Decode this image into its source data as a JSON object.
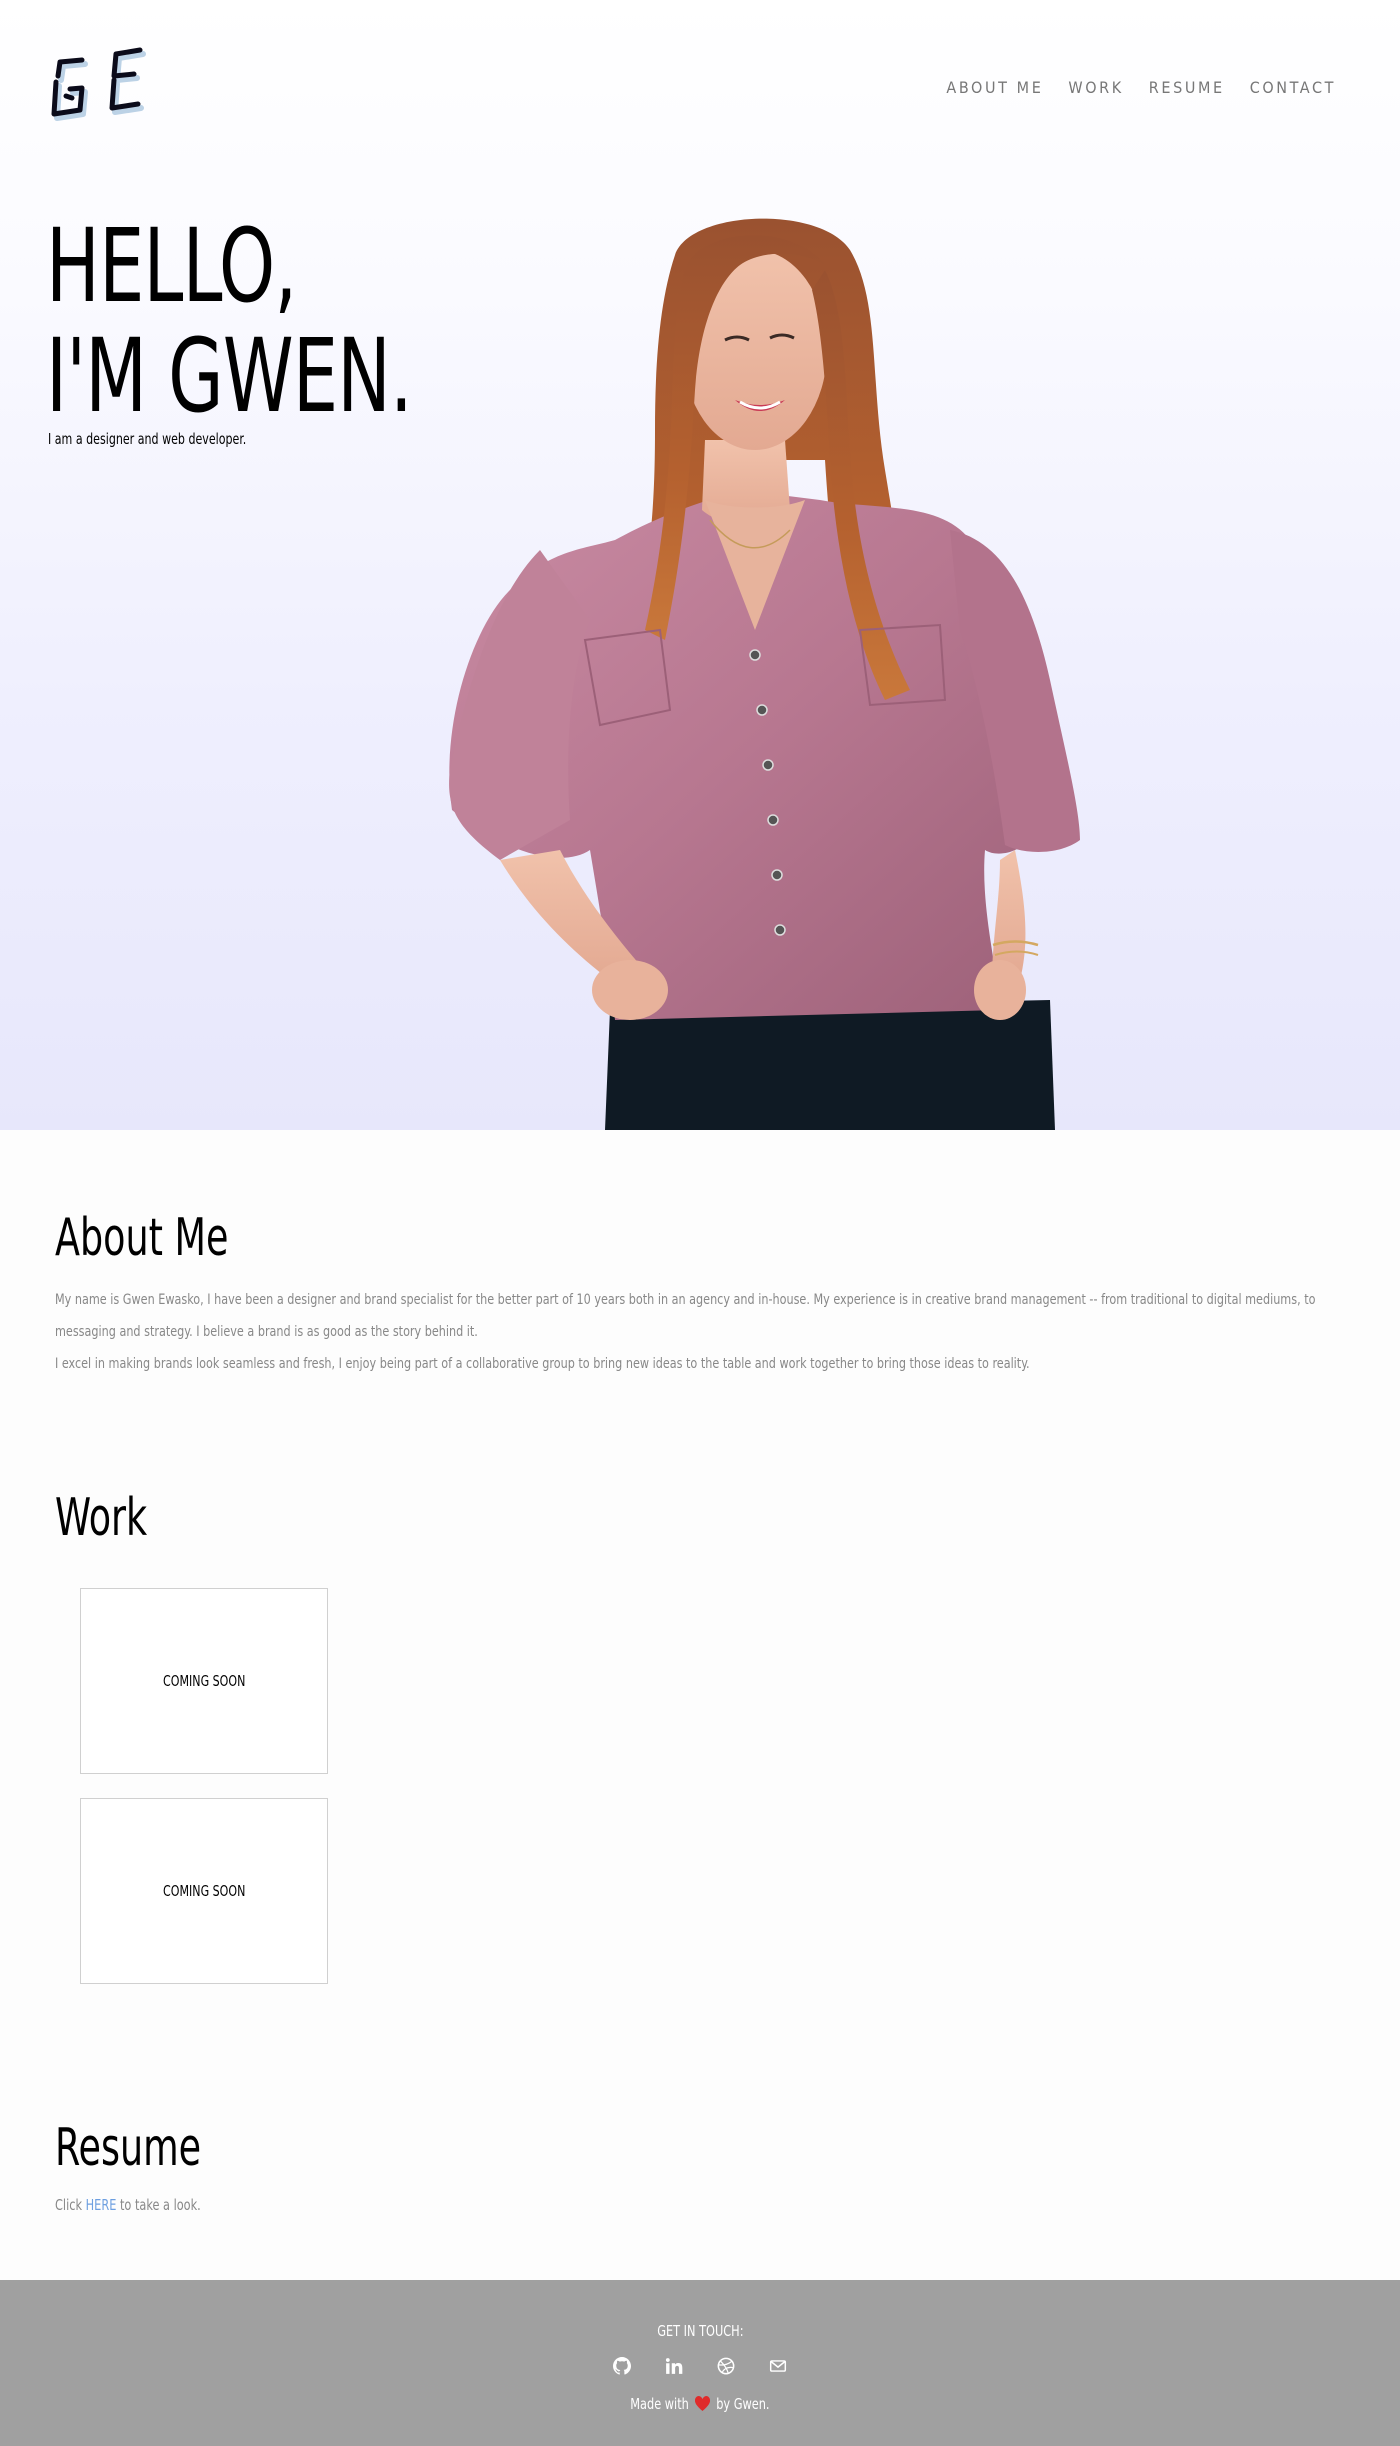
{
  "nav": {
    "items": [
      {
        "label": "ABOUT ME"
      },
      {
        "label": "WORK"
      },
      {
        "label": "RESUME"
      },
      {
        "label": "CONTACT"
      }
    ]
  },
  "hero": {
    "title_line1": "HELLO,",
    "title_line2": "I'M GWEN.",
    "subtitle": "I am a designer and web developer."
  },
  "about": {
    "heading": "About Me",
    "paragraph1": "My name is Gwen Ewasko, I have been a designer and brand specialist for the better part of 10 years both in an agency and in-house. My experience is in creative brand management -- from traditional to digital mediums, to messaging and strategy. I believe a brand is as good as the story behind it.",
    "paragraph2": "I excel in making brands look seamless and fresh, I enjoy being part of a collaborative group to bring new ideas to the table and work together to bring those ideas to reality."
  },
  "work": {
    "heading": "Work",
    "cards": [
      {
        "label": "COMING SOON"
      },
      {
        "label": "COMING SOON"
      }
    ]
  },
  "resume": {
    "heading": "Resume",
    "prefix": "Click",
    "link_label": "HERE",
    "suffix": "to take a look."
  },
  "footer": {
    "title": "GET IN TOUCH:",
    "social_icons": [
      "github-icon",
      "linkedin-icon",
      "dribbble-icon",
      "mail-icon"
    ],
    "made_prefix": "Made with",
    "made_suffix": "by Gwen."
  },
  "colors": {
    "link": "#6d9fe0",
    "footer_bg": "#a0a0a0",
    "nav_text": "#777777",
    "body_text": "#888888"
  }
}
